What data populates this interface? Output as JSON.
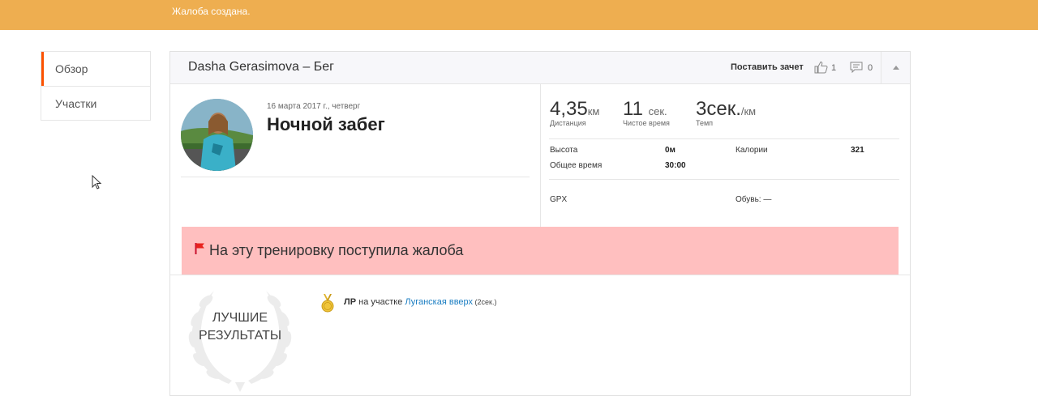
{
  "notice": {
    "text": "Жалоба создана."
  },
  "sidebar": {
    "items": [
      {
        "label": "Обзор"
      },
      {
        "label": "Участки"
      }
    ]
  },
  "header": {
    "title": "Dasha Gerasimova – Бег",
    "kudos_button": "Поставить зачет",
    "kudos_count": "1",
    "comment_count": "0",
    "icons": {
      "kudos": "thumbs-up-icon",
      "comments": "comment-icon",
      "collapse": "chevron-up-icon"
    }
  },
  "activity": {
    "date": "16 марта 2017 г., четверг",
    "title": "Ночной забег"
  },
  "stats": {
    "distance": {
      "value": "4,35",
      "unit": "км",
      "label": "Дистанция"
    },
    "moving_time": {
      "value": "11",
      "unit": "сек.",
      "label": "Чистое время"
    },
    "pace": {
      "value": "3",
      "unit_a": "сек.",
      "unit_b": "/км",
      "label": "Темп"
    },
    "elevation": {
      "label": "Высота",
      "value": "0м"
    },
    "calories": {
      "label": "Калории",
      "value": "321"
    },
    "elapsed": {
      "label": "Общее время",
      "value": "30:00"
    },
    "gpx": {
      "label": "GPX"
    },
    "shoes": {
      "label": "Обувь: —"
    }
  },
  "flag": {
    "text": "На эту тренировку поступила жалоба",
    "color": "#ffbfbf",
    "icon": "flag-icon"
  },
  "best": {
    "line1": "ЛУЧШИЕ",
    "line2": "РЕЗУЛЬТАТЫ",
    "achievement": {
      "badge": "ЛР",
      "middle": " на участке ",
      "segment": "Луганская вверх",
      "time": " (2сек.)"
    }
  },
  "colors": {
    "notice_bar": "#eeae50",
    "accent": "#fc5200",
    "link": "#1a7dc2"
  }
}
